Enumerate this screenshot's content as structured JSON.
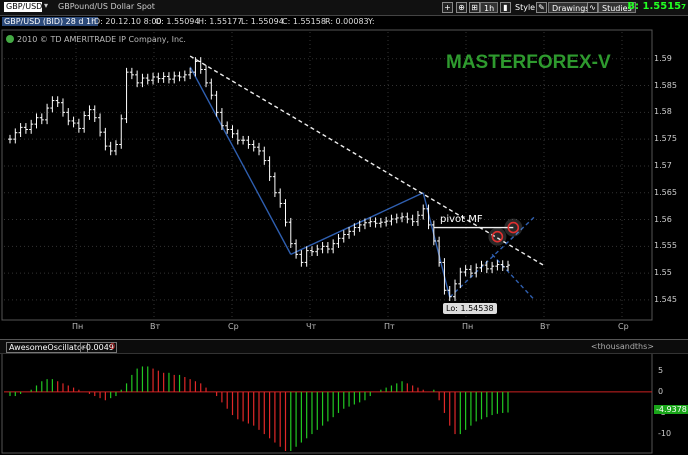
{
  "toolbar": {
    "symbol": "GBP/USD",
    "description": "GBPound/US Dollar Spot",
    "timeframe": "1h",
    "style_label": "Style",
    "drawings_label": "Drawings",
    "studies_label": "Studies",
    "bid_price": "B: 1.5515",
    "bid_price_suffix": "7"
  },
  "info": {
    "symbol_tag": "GBP/USD (BID) 28 d 1h",
    "date": "D: 20.12.10 8:00",
    "open": "O: 1.55094",
    "high": "H: 1.55177",
    "low": "L: 1.55094",
    "close": "C: 1.55158",
    "change": "R: 0.00083",
    "y": "Y:"
  },
  "copyright": "2010 © TD AMERITRADE IP Company, Inc.",
  "watermark": "MASTERFOREX-V",
  "annotations": {
    "pivot": "pivot MF",
    "low": "Lo: 1.54538"
  },
  "chart_data": [
    {
      "type": "line",
      "title": "",
      "x_ticks": [
        "Пн",
        "Вт",
        "Ср",
        "Чт",
        "Пт",
        "Пн",
        "Вт",
        "Ср"
      ],
      "y_ticks": [
        "1.59",
        "1.585",
        "1.58",
        "1.575",
        "1.57",
        "1.565",
        "1.56",
        "1.555",
        "1.55",
        "1.545"
      ],
      "ylim": [
        1.542,
        1.5935
      ],
      "grid": true,
      "series": [
        {
          "values": [
            1.575,
            1.5762,
            1.5772,
            1.5768,
            1.5778,
            1.579,
            1.5786,
            1.5808,
            1.5822,
            1.5818,
            1.58,
            1.5784,
            1.578,
            1.577,
            1.5794,
            1.5805,
            1.579,
            1.5763,
            1.5737,
            1.5728,
            1.574,
            1.5788,
            1.5875,
            1.587,
            1.5855,
            1.5864,
            1.586,
            1.5866,
            1.5863,
            1.5867,
            1.5862,
            1.5868,
            1.5866,
            1.587,
            1.5875,
            1.5895,
            1.588,
            1.5855,
            1.5832,
            1.58,
            1.5775,
            1.5768,
            1.576,
            1.5748,
            1.5748,
            1.574,
            1.5735,
            1.5728,
            1.571,
            1.568,
            1.565,
            1.563,
            1.5595,
            1.5555,
            1.5535,
            1.552,
            1.5542,
            1.554,
            1.5545,
            1.555,
            1.5545,
            1.5555,
            1.5565,
            1.5572,
            1.5578,
            1.5585,
            1.559,
            1.5594,
            1.5596,
            1.5593,
            1.5595,
            1.5597,
            1.5601,
            1.5603,
            1.5605,
            1.5601,
            1.5596,
            1.5608,
            1.562,
            1.559,
            1.556,
            1.552,
            1.5468,
            1.5456,
            1.548,
            1.5502,
            1.5507,
            1.55,
            1.551,
            1.5515,
            1.5508,
            1.5513,
            1.5516,
            1.5512,
            1.5515
          ]
        }
      ],
      "lines": [
        {
          "style": "solid",
          "color": "#2f5fb0",
          "x": [
            34,
            53
          ],
          "y": [
            1.5885,
            1.5535
          ]
        },
        {
          "style": "solid",
          "color": "#2f5fb0",
          "x": [
            53,
            78
          ],
          "y": [
            1.5535,
            1.565
          ]
        },
        {
          "style": "solid",
          "color": "#2f5fb0",
          "x": [
            78,
            83
          ],
          "y": [
            1.565,
            1.5455
          ]
        },
        {
          "style": "dashed",
          "color": "#eeeeee",
          "x": [
            34,
            101
          ],
          "y": [
            1.5905,
            1.5513
          ]
        },
        {
          "style": "dashed",
          "color": "#2f5fb0",
          "x": [
            83,
            99
          ],
          "y": [
            1.5455,
            1.5605
          ]
        },
        {
          "style": "dashed",
          "color": "#2f5fb0",
          "x": [
            91,
            99
          ],
          "y": [
            1.5535,
            1.545
          ]
        },
        {
          "style": "solid",
          "color": "#eeeeee",
          "x": [
            80,
            95
          ],
          "y": [
            1.5585,
            1.5585
          ]
        }
      ],
      "circles": [
        {
          "x": 95,
          "y": 1.5585,
          "color": "#e03030"
        },
        {
          "x": 92,
          "y": 1.5568,
          "color": "#e03030"
        }
      ]
    },
    {
      "type": "bar",
      "title": "AwesomeOscillator",
      "value_label": "-0.0049",
      "value_label_2": "0",
      "unit_label": "<thousandths>",
      "y_ticks": [
        "5",
        "0",
        "-5",
        "-10"
      ],
      "ylim": [
        -14,
        8
      ],
      "current_value": "-4.9378",
      "values": [
        -1,
        -1,
        -0.5,
        0,
        0.5,
        1.5,
        2.5,
        3,
        3,
        2.5,
        2,
        1.5,
        1,
        0.5,
        0,
        -0.5,
        -1,
        -1.5,
        -2,
        -1.5,
        -1,
        0.5,
        2,
        4,
        5.5,
        6,
        6,
        5.5,
        5,
        4.5,
        4.5,
        4,
        4,
        3.5,
        3,
        2.5,
        2,
        1,
        0,
        -1,
        -2.5,
        -4,
        -5.5,
        -6.5,
        -7,
        -7.5,
        -8,
        -9,
        -10,
        -11,
        -12,
        -13,
        -14,
        -14,
        -13,
        -12,
        -11,
        -10,
        -9,
        -8,
        -7,
        -6,
        -5,
        -4,
        -3.5,
        -3,
        -2.5,
        -2,
        -1,
        0,
        0.5,
        1,
        1.5,
        2,
        2.5,
        2,
        1.5,
        1,
        0.5,
        0,
        0.5,
        -2,
        -5,
        -8,
        -10,
        -10,
        -9,
        -8,
        -7,
        -6.5,
        -6,
        -5.5,
        -5.2,
        -5,
        -4.9
      ]
    }
  ]
}
